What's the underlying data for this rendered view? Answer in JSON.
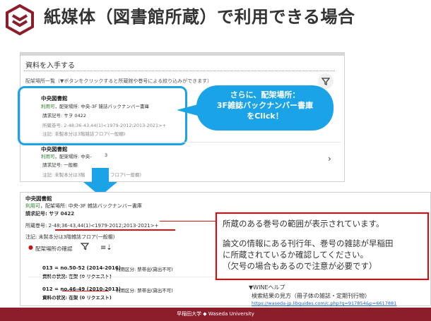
{
  "slide": {
    "title": "紙媒体（図書館所蔵）で利用できる場合",
    "logo_icon": "waseda-library-logo-icon",
    "brand_color": "#8c1d2a"
  },
  "top_panel": {
    "section_title": "資料を入手する",
    "location_list_label": "配架場所一覧（▼ボタンをクリックすると所蔵館や巻号による絞り込みができます）",
    "filter_icon": "filter-icon",
    "item1": {
      "library": "中央図書館",
      "status": "利用可",
      "location": "，配架場所: 中央-3F 雑誌バックナンバー書庫",
      "call_number": "請求記号: サヲ 0422",
      "holdings": "所蔵巻号: 2-48;36-43,44(1)<1979-2012;2013-2021>+",
      "note": "注記: 未製本分は3階雑誌フロア(一般棚)"
    },
    "item2": {
      "library": "中央図書館",
      "status": "利用可",
      "location": "，配架場所: 中央-",
      "location_tail": "3",
      "call_number": "請求記号: 一般棚",
      "note_a": "注記: 未製本分は3階",
      "note_b": "フロア(一般棚)",
      "chevron": "›"
    },
    "callout_lines": [
      "さらに、配架場所：",
      "3F雑誌バックナンバー書庫",
      "をClick！"
    ],
    "highlight_color": "#1ba3e8"
  },
  "bottom_panel": {
    "library": "中央図書館",
    "status": "利用可",
    "location": "，配架場所: 中央-3F 雑誌バックナンバー書庫",
    "call_number": "請求記号: サヲ 0422",
    "holdings_label": "所蔵巻号: ",
    "holdings_value": "2-48;36-43,44(1)<1979-2012;2013-2021>+",
    "note": "注記: 未製本分は3階雑誌フロア(一般棚)",
    "location_confirm": "配架場所の確認",
    "sort_icon": "≡⇣",
    "volumes": [
      {
        "label_a": "013 = no.50-52 (2014-2016)",
        "usage": "利用区分: 禁帯出(貸出不可)",
        "status": "資料の状況: 在架 (0 リクエスト)"
      },
      {
        "label_a": "012 = ",
        "label_b": "no.46-49 (2010-2013)",
        "usage": "利用区分: 禁帯出(貸出不可)",
        "status": "資料の状況: 在架 (0 リクエスト)"
      }
    ]
  },
  "info_box": {
    "line1": "所蔵のある巻号の範囲が表示されています。",
    "line2": "論文の情報にある刊行年、巻号の雑誌が早稲田",
    "line3": "に所蔵されているか確認してください。",
    "line4": "（欠号の場合もあるので注意が必要です）",
    "accent_color": "#e00000"
  },
  "wine_help": {
    "title": "▼WINEヘルプ",
    "text": "検索結果の見方（冊子体の雑誌・定期刊行物）",
    "url": "https://waseda-jp.libguides.com/c.php?g=917854&p=6617881"
  },
  "footer": {
    "text": "早稲田大学 ◆ Waseda University"
  }
}
